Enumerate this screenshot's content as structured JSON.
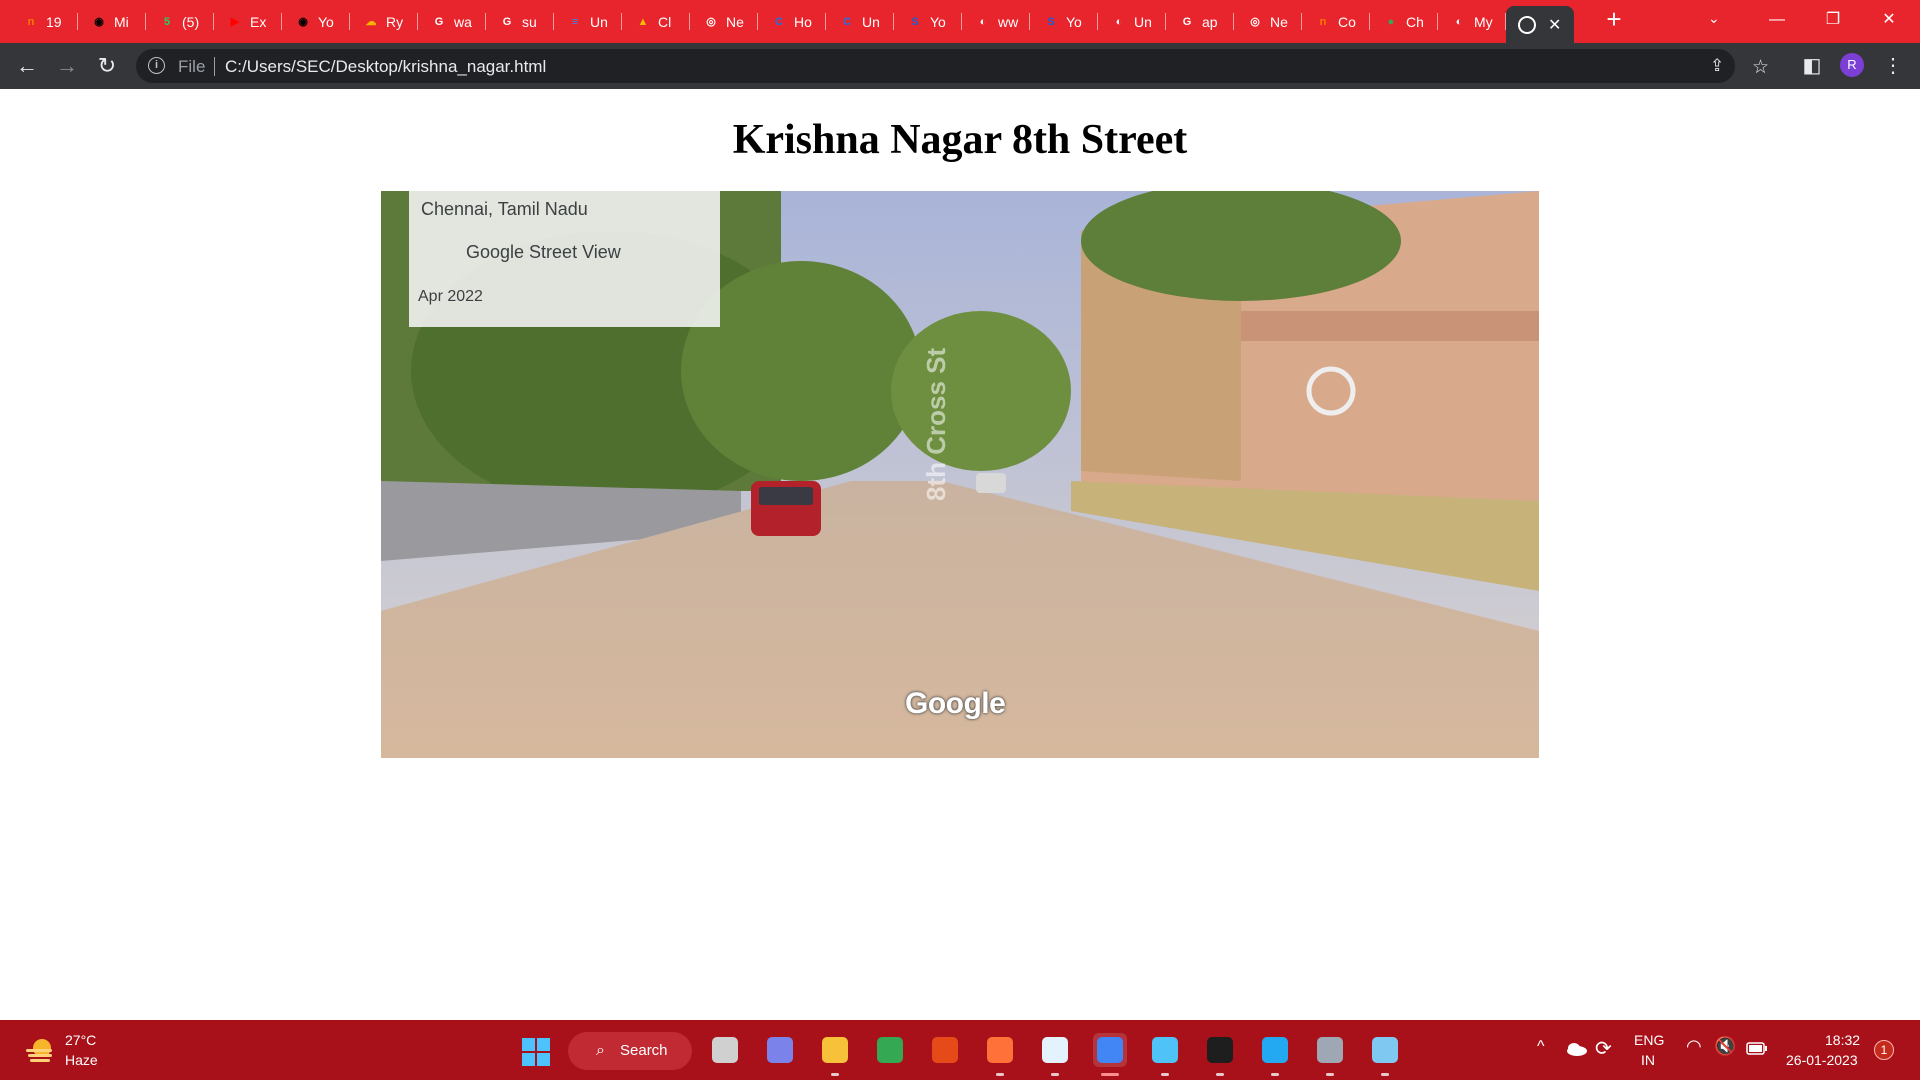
{
  "tabs": [
    {
      "label": "19",
      "icon": "notification-app-icon",
      "color": "#ff7a00",
      "glyph": "n"
    },
    {
      "label": "Mi",
      "icon": "github-icon",
      "color": "#000000",
      "glyph": "◉"
    },
    {
      "label": "(5)",
      "icon": "whatsapp-icon",
      "color": "#25d366",
      "glyph": "5"
    },
    {
      "label": "Ex",
      "icon": "youtube-icon",
      "color": "#ff0000",
      "glyph": "▶"
    },
    {
      "label": "Yo",
      "icon": "github-icon",
      "color": "#000000",
      "glyph": "◉"
    },
    {
      "label": "Ry",
      "icon": "cloud-app-icon",
      "color": "#f5b400",
      "glyph": "☁"
    },
    {
      "label": "wa",
      "icon": "google-icon",
      "color": "#ffffff",
      "glyph": "G"
    },
    {
      "label": "su",
      "icon": "google-icon",
      "color": "#ffffff",
      "glyph": "G"
    },
    {
      "label": "Un",
      "icon": "google-docs-icon",
      "color": "#4285f4",
      "glyph": "≡"
    },
    {
      "label": "Cl",
      "icon": "google-drive-icon",
      "color": "#fbbc04",
      "glyph": "▲"
    },
    {
      "label": "Ne",
      "icon": "chrome-icon",
      "color": "#ffffff",
      "glyph": "◎"
    },
    {
      "label": "Ho",
      "icon": "c-app-icon",
      "color": "#1a73e8",
      "glyph": "C"
    },
    {
      "label": "Un",
      "icon": "c-app-icon",
      "color": "#1a73e8",
      "glyph": "C"
    },
    {
      "label": "Yo",
      "icon": "s-app-icon",
      "color": "#1a5fd6",
      "glyph": "S"
    },
    {
      "label": "ww",
      "icon": "globe-icon",
      "color": "#ffffff",
      "glyph": "◐"
    },
    {
      "label": "Yo",
      "icon": "s-app-icon",
      "color": "#1a5fd6",
      "glyph": "S"
    },
    {
      "label": "Un",
      "icon": "globe-icon",
      "color": "#ffffff",
      "glyph": "◐"
    },
    {
      "label": "ap",
      "icon": "google-icon",
      "color": "#ffffff",
      "glyph": "G"
    },
    {
      "label": "Ne",
      "icon": "chrome-icon",
      "color": "#ffffff",
      "glyph": "◎"
    },
    {
      "label": "Co",
      "icon": "notification-app-icon",
      "color": "#ff7a00",
      "glyph": "n"
    },
    {
      "label": "Ch",
      "icon": "maps-pin-icon",
      "color": "#34a853",
      "glyph": "●"
    },
    {
      "label": "My",
      "icon": "globe-icon",
      "color": "#ffffff",
      "glyph": "◐"
    }
  ],
  "active_tab": {
    "icon": "globe-icon",
    "close": "✕"
  },
  "window": {
    "new_tab": "+",
    "tab_search": "⌄",
    "minimize": "—",
    "restore": "❐",
    "close": "✕"
  },
  "toolbar": {
    "back": "←",
    "forward": "→",
    "reload": "↻",
    "info_glyph": "i",
    "scheme_label": "File",
    "url": "C:/Users/SEC/Desktop/krishna_nagar.html",
    "share": "⇪",
    "bookmark": "☆",
    "side_panel": "◧",
    "menu": "⋮",
    "profile_initial": "R"
  },
  "page": {
    "title": "Krishna Nagar 8th Street",
    "streetview": {
      "place": "Chennai, Tamil Nadu",
      "provider": "Google Street View",
      "date": "Apr 2022",
      "road_marking": "8th Cross St",
      "logo": "Google"
    }
  },
  "taskbar": {
    "weather_temp": "27°C",
    "weather_desc": "Haze",
    "search_label": "Search",
    "search_glyph": "⌕",
    "apps": [
      {
        "name": "task-view-icon",
        "color": "#d0d0d0",
        "running": false
      },
      {
        "name": "teams-meet-icon",
        "color": "#7b83eb",
        "running": false
      },
      {
        "name": "file-explorer-icon",
        "color": "#f8c13a",
        "running": true
      },
      {
        "name": "chrome-icon",
        "color": "#34a853",
        "running": false
      },
      {
        "name": "color-wheel-icon",
        "color": "#e64a19",
        "running": false
      },
      {
        "name": "firefox-icon",
        "color": "#ff7139",
        "running": true
      },
      {
        "name": "file-editor-icon",
        "color": "#e3f2fd",
        "running": true
      },
      {
        "name": "chrome-profile-icon",
        "color": "#4285f4",
        "running": true,
        "active": true
      },
      {
        "name": "notepad-icon",
        "color": "#4fc3f7",
        "running": true
      },
      {
        "name": "terminal-icon",
        "color": "#1e1e1e",
        "running": true
      },
      {
        "name": "vscode-icon",
        "color": "#23a9f2",
        "running": true
      },
      {
        "name": "settings-icon",
        "color": "#9ea7b3",
        "running": true
      },
      {
        "name": "paint-icon",
        "color": "#7ec8f2",
        "running": true
      }
    ],
    "tray_chevron": "^",
    "lang_top": "ENG",
    "lang_bottom": "IN",
    "time": "18:32",
    "date": "26-01-2023",
    "notification_count": "1"
  }
}
